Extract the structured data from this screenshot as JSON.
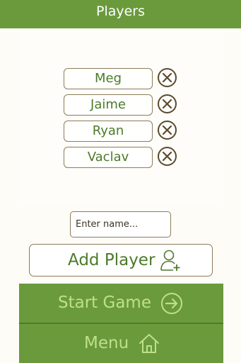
{
  "header": {
    "title": "Players"
  },
  "players": [
    {
      "name": "Meg"
    },
    {
      "name": "Jaime"
    },
    {
      "name": "Ryan"
    },
    {
      "name": "Vaclav"
    }
  ],
  "name_input": {
    "placeholder": "Enter name...",
    "value": ""
  },
  "add_button": {
    "label": "Add Player",
    "icon": "add-user-icon"
  },
  "start_button": {
    "label": "Start Game",
    "icon": "arrow-right-circle-icon"
  },
  "menu_button": {
    "label": "Menu",
    "icon": "home-icon"
  },
  "colors": {
    "primary_green": "#6a9a3c",
    "button_text_light": "#bfe08a",
    "name_text": "#4c7a2a",
    "border": "#8c7b5a",
    "remove_icon": "#5a4a2e",
    "background": "#fdfcf7"
  }
}
